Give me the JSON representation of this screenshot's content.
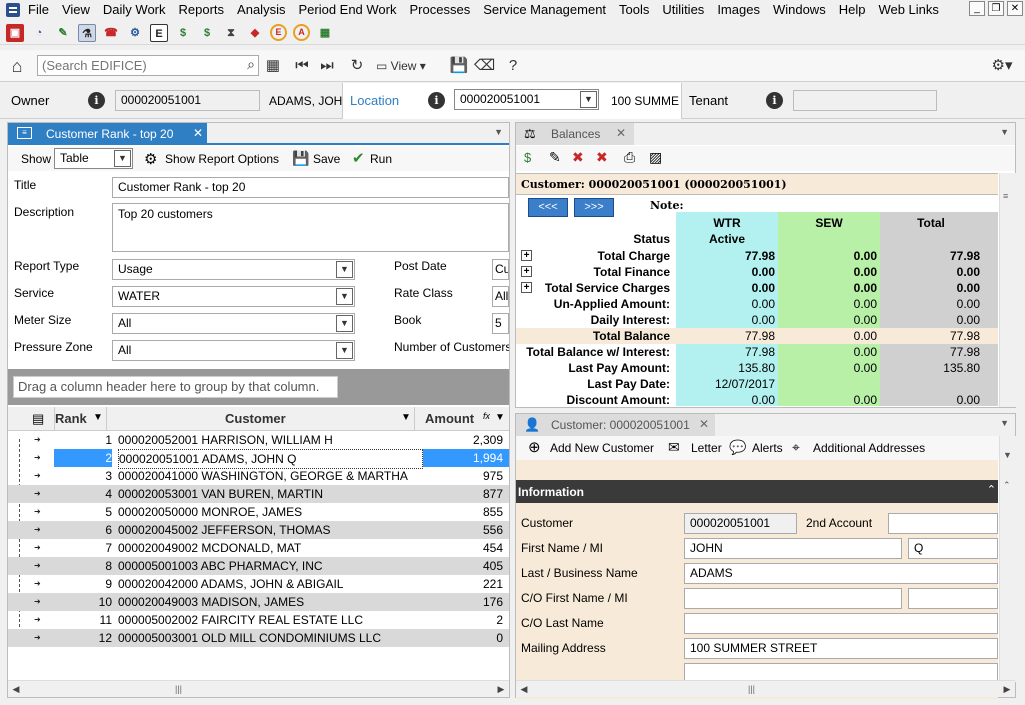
{
  "menu": {
    "items": [
      "File",
      "View",
      "Daily Work",
      "Reports",
      "Analysis",
      "Period End Work",
      "Processes",
      "Service Management",
      "Tools",
      "Utilities",
      "Images",
      "Windows",
      "Help",
      "Web Links"
    ],
    "window_controls": [
      "_",
      "❐",
      "✕"
    ]
  },
  "toolbar2": {
    "search_placeholder": "(Search EDIFICE)",
    "view_label": "View"
  },
  "ownerbar": {
    "owner_label": "Owner",
    "owner_id": "000020051001",
    "owner_name": "ADAMS, JOH",
    "location_label": "Location",
    "location_id": "000020051001",
    "location_addr": "100 SUMME",
    "tenant_label": "Tenant",
    "tenant_value": ""
  },
  "report": {
    "tab_label": "Customer Rank - top 20",
    "show_label": "Show",
    "show_value": "Table",
    "show_options_label": "Show Report Options",
    "save_label": "Save",
    "run_label": "Run",
    "title_label": "Title",
    "title_value": "Customer Rank - top 20",
    "description_label": "Description",
    "description_value": "Top 20 customers",
    "report_type_label": "Report Type",
    "report_type_value": "Usage",
    "service_label": "Service",
    "service_value": "WATER",
    "meter_size_label": "Meter Size",
    "meter_size_value": "All",
    "pressure_zone_label": "Pressure Zone",
    "pressure_zone_value": "All",
    "post_date_label": "Post Date",
    "post_date_value": "Cu",
    "rate_class_label": "Rate Class",
    "rate_class_value": "All",
    "book_label": "Book",
    "book_value": "5",
    "num_customers_label": "Number of Customers T",
    "group_hint": "Drag a column header here to group by that column.",
    "columns": {
      "rank": "Rank",
      "customer": "Customer",
      "amount": "Amount"
    },
    "rows": [
      {
        "rank": "1",
        "customer": "000020052001 HARRISON, WILLIAM H",
        "amount": "2,309"
      },
      {
        "rank": "2",
        "customer": "000020051001 ADAMS, JOHN Q",
        "amount": "1,994"
      },
      {
        "rank": "3",
        "customer": "000020041000 WASHINGTON, GEORGE & MARTHA",
        "amount": "975"
      },
      {
        "rank": "4",
        "customer": "000020053001 VAN BUREN, MARTIN",
        "amount": "877"
      },
      {
        "rank": "5",
        "customer": "000020050000 MONROE, JAMES",
        "amount": "855"
      },
      {
        "rank": "6",
        "customer": "000020045002 JEFFERSON, THOMAS",
        "amount": "556"
      },
      {
        "rank": "7",
        "customer": "000020049002 MCDONALD, MAT",
        "amount": "454"
      },
      {
        "rank": "8",
        "customer": "000005001003 ABC PHARMACY, INC",
        "amount": "405"
      },
      {
        "rank": "9",
        "customer": "000020042000 ADAMS, JOHN & ABIGAIL",
        "amount": "221"
      },
      {
        "rank": "10",
        "customer": "000020049003 MADISON, JAMES",
        "amount": "176"
      },
      {
        "rank": "11",
        "customer": "000005002002 FAIRCITY REAL ESTATE LLC",
        "amount": "2"
      },
      {
        "rank": "12",
        "customer": "000005003001 OLD MILL CONDOMINIUMS LLC",
        "amount": "0"
      }
    ]
  },
  "balances": {
    "tab_label": "Balances",
    "customer_line": "Customer: 000020051001 (000020051001)",
    "prev_label": "<<<",
    "next_label": ">>>",
    "note_label": "Note:",
    "col_wtr": "WTR",
    "col_sew": "SEW",
    "col_total": "Total",
    "status_label": "Status",
    "status_wtr": "Active",
    "rows": [
      {
        "label": "Total Charge",
        "wtr": "77.98",
        "sew": "0.00",
        "total": "77.98",
        "plus": true,
        "bold": true
      },
      {
        "label": "Total Finance",
        "wtr": "0.00",
        "sew": "0.00",
        "total": "0.00",
        "plus": true,
        "bold": true
      },
      {
        "label": "Total Service Charges",
        "wtr": "0.00",
        "sew": "0.00",
        "total": "0.00",
        "plus": true,
        "bold": true
      },
      {
        "label": "Un-Applied Amount:",
        "wtr": "0.00",
        "sew": "0.00",
        "total": "0.00",
        "plus": false,
        "bold": false
      },
      {
        "label": "Daily Interest:",
        "wtr": "0.00",
        "sew": "0.00",
        "total": "0.00",
        "plus": false,
        "bold": false
      },
      {
        "label": "Total Balance",
        "wtr": "77.98",
        "sew": "0.00",
        "total": "77.98",
        "plus": false,
        "bold": false
      },
      {
        "label": "Total Balance w/ Interest:",
        "wtr": "77.98",
        "sew": "0.00",
        "total": "77.98",
        "plus": false,
        "bold": false
      },
      {
        "label": "Last Pay Amount:",
        "wtr": "135.80",
        "sew": "0.00",
        "total": "135.80",
        "plus": false,
        "bold": false
      },
      {
        "label": "Last Pay Date:",
        "wtr": "12/07/2017",
        "sew": "",
        "total": "",
        "plus": false,
        "bold": false
      },
      {
        "label": "Discount Amount:",
        "wtr": "0.00",
        "sew": "0.00",
        "total": "0.00",
        "plus": false,
        "bold": false
      }
    ]
  },
  "customer": {
    "tab_label": "Customer: 000020051001",
    "add_new_label": "Add New Customer",
    "letter_label": "Letter",
    "alerts_label": "Alerts",
    "additional_addresses_label": "Additional Addresses",
    "info_header": "Information",
    "customer_label": "Customer",
    "customer_value": "000020051001",
    "second_account_label": "2nd Account",
    "second_account_value": "",
    "first_name_label": "First Name / MI",
    "first_name_value": "JOHN",
    "mi_value": "Q",
    "last_name_label": "Last / Business Name",
    "last_name_value": "ADAMS",
    "co_first_label": "C/O First Name / MI",
    "co_first_value": "",
    "co_mi_value": "",
    "co_last_label": "C/O Last Name",
    "co_last_value": "",
    "mailing_label": "Mailing Address",
    "mailing_value": "100 SUMMER STREET",
    "mailing2_value": ""
  },
  "colors": {
    "tab_blue": "#2f7fc4",
    "selected_row": "#3399ff",
    "wtr_col": "#b3f0f0",
    "sew_col": "#b8f0a8",
    "total_col": "#d0d0d0",
    "cream": "#f8ead8",
    "info_header_bg": "#3a3a3a"
  }
}
